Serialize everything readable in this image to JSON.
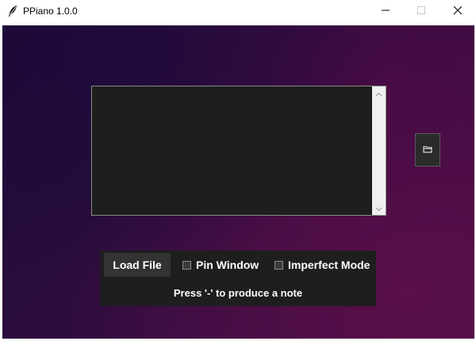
{
  "window": {
    "title": "PPiano 1.0.0",
    "icons": {
      "app": "feather-icon",
      "minimize": "minimize-icon",
      "maximize": "maximize-icon",
      "close": "close-icon"
    }
  },
  "editor": {
    "value": "",
    "icons": {
      "scroll_up": "chevron-up-icon",
      "scroll_down": "chevron-down-icon"
    }
  },
  "folder_button": {
    "icon": "folder-icon"
  },
  "controls": {
    "load_label": "Load File",
    "pin_label": "Pin Window",
    "pin_checked": false,
    "imperfect_label": "Imperfect Mode",
    "imperfect_checked": false,
    "hint": "Press '-' to produce a note"
  },
  "colors": {
    "panel_bg": "#1e1e1e",
    "button_bg": "#333333",
    "text": "#ffffff",
    "background_start": "#1c0b32",
    "background_end": "#4a0f46"
  }
}
